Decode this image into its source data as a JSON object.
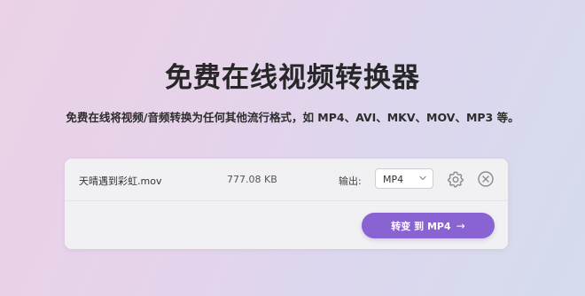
{
  "header": {
    "title": "免费在线视频转换器",
    "subtitle": "免费在线将视频/音频转换为任何其他流行格式，如 MP4、AVI、MKV、MOV、MP3 等。"
  },
  "file": {
    "name": "天晴遇到彩虹.mov",
    "size": "777.08 KB",
    "output_label": "输出:",
    "format": "MP4"
  },
  "convert_button": {
    "label": "转变 到 MP4",
    "arrow": "→"
  },
  "colors": {
    "accent": "#8a63d2",
    "card_bg": "#f1f1f3"
  },
  "icons": [
    "chevron-down-icon",
    "gear-icon",
    "close-icon",
    "arrow-right-icon"
  ]
}
